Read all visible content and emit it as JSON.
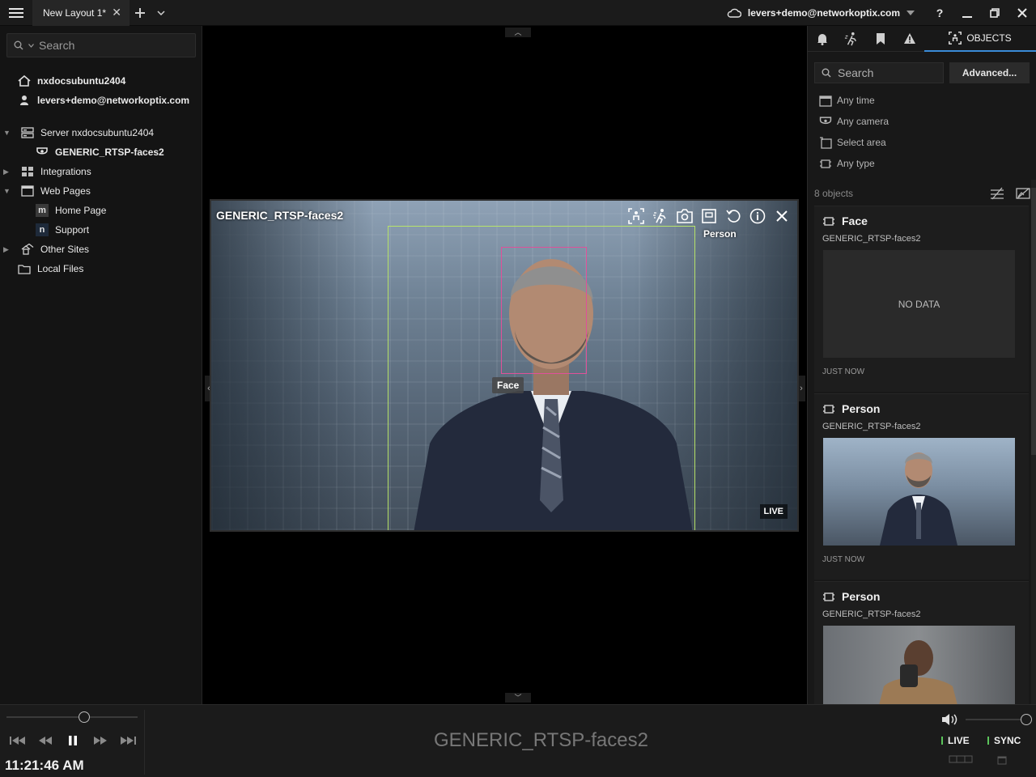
{
  "titlebar": {
    "tab_label": "New Layout 1*",
    "account": "levers+demo@networkoptix.com",
    "help": "?"
  },
  "left_panel": {
    "search_placeholder": "Search",
    "tree": {
      "system": "nxdocsubuntu2404",
      "user": "levers+demo@networkoptix.com",
      "server": "Server nxdocsubuntu2404",
      "camera": "GENERIC_RTSP-faces2",
      "integrations": "Integrations",
      "web_pages": "Web Pages",
      "home_page": "Home Page",
      "support": "Support",
      "other_sites": "Other Sites",
      "local_files": "Local Files"
    },
    "badges": {
      "home": "m",
      "support": "n"
    }
  },
  "camera_item": {
    "title": "GENERIC_RTSP-faces2",
    "person_label": "Person",
    "face_label": "Face",
    "live_label": "LIVE"
  },
  "right_panel": {
    "objects_tab": "OBJECTS",
    "search_placeholder": "Search",
    "advanced_button": "Advanced...",
    "filters": {
      "time": "Any time",
      "camera": "Any camera",
      "area": "Select area",
      "type": "Any type"
    },
    "count": "8 objects",
    "tiles": [
      {
        "type": "Face",
        "camera": "GENERIC_RTSP-faces2",
        "preview": "NO DATA",
        "time": "JUST NOW"
      },
      {
        "type": "Person",
        "camera": "GENERIC_RTSP-faces2",
        "preview": "",
        "time": "JUST NOW"
      },
      {
        "type": "Person",
        "camera": "GENERIC_RTSP-faces2",
        "preview": "",
        "time": ""
      }
    ]
  },
  "bottom_bar": {
    "clock": "11:21:46 AM",
    "camera_name": "GENERIC_RTSP-faces2",
    "live_button": "LIVE",
    "sync_button": "SYNC",
    "timeline_position": 0.59,
    "volume_level": 1.0
  },
  "colors": {
    "person_box": "#b7e36a",
    "face_box": "#e0509a",
    "accent": "#3a8bd8",
    "live_indicator": "#5bc45b"
  }
}
